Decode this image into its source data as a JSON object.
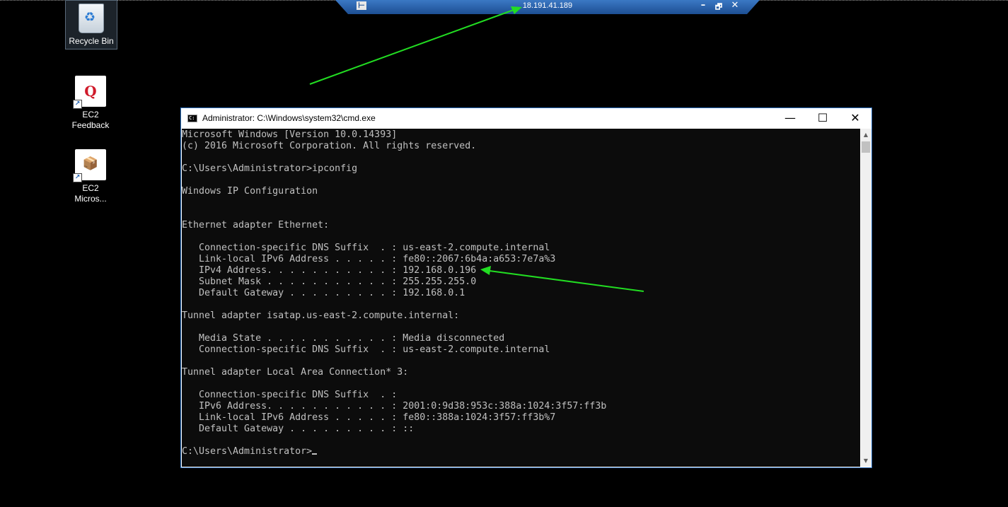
{
  "rdp_bar": {
    "host": "18.191.41.189",
    "minimize": "–",
    "restore": "🗗",
    "close": "✕"
  },
  "desktop": {
    "icons": [
      {
        "label": "Recycle Bin",
        "icon": "recycle-bin-icon"
      },
      {
        "label": "EC2\nFeedback",
        "icon": "ec2-feedback-icon",
        "glyph": "Q"
      },
      {
        "label": "EC2\nMicros...",
        "icon": "ec2-microsoft-icon",
        "glyph": "📦"
      }
    ]
  },
  "cmd_window": {
    "title": "Administrator: C:\\Windows\\system32\\cmd.exe",
    "minimize": "—",
    "maximize": "☐",
    "close": "✕",
    "console_lines": [
      "Microsoft Windows [Version 10.0.14393]",
      "(c) 2016 Microsoft Corporation. All rights reserved.",
      "",
      "C:\\Users\\Administrator>ipconfig",
      "",
      "Windows IP Configuration",
      "",
      "",
      "Ethernet adapter Ethernet:",
      "",
      "   Connection-specific DNS Suffix  . : us-east-2.compute.internal",
      "   Link-local IPv6 Address . . . . . : fe80::2067:6b4a:a653:7e7a%3",
      "   IPv4 Address. . . . . . . . . . . : 192.168.0.196",
      "   Subnet Mask . . . . . . . . . . . : 255.255.255.0",
      "   Default Gateway . . . . . . . . . : 192.168.0.1",
      "",
      "Tunnel adapter isatap.us-east-2.compute.internal:",
      "",
      "   Media State . . . . . . . . . . . : Media disconnected",
      "   Connection-specific DNS Suffix  . : us-east-2.compute.internal",
      "",
      "Tunnel adapter Local Area Connection* 3:",
      "",
      "   Connection-specific DNS Suffix  . :",
      "   IPv6 Address. . . . . . . . . . . : 2001:0:9d38:953c:388a:1024:3f57:ff3b",
      "   Link-local IPv6 Address . . . . . : fe80::388a:1024:3f57:ff3b%7",
      "   Default Gateway . . . . . . . . . : ::",
      ""
    ],
    "prompt": "C:\\Users\\Administrator>"
  },
  "colors": {
    "annotation_arrow": "#22dd22",
    "rdp_bar": "#1d4f93",
    "console_bg": "#0c0c0c",
    "console_text": "#c0c0c0"
  }
}
